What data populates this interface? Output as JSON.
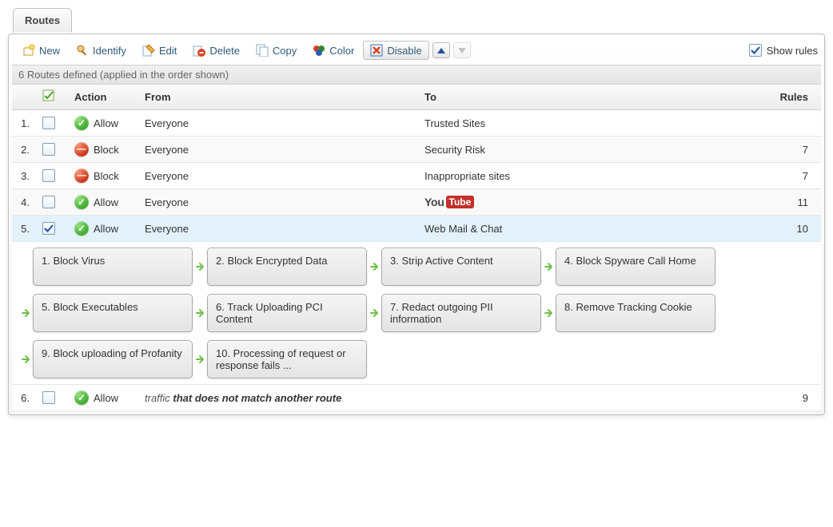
{
  "tab": {
    "label": "Routes"
  },
  "toolbar": {
    "new": {
      "label": "New",
      "icon": "new-icon"
    },
    "identify": {
      "label": "Identify",
      "icon": "identify-icon"
    },
    "edit": {
      "label": "Edit",
      "icon": "edit-icon"
    },
    "delete": {
      "label": "Delete",
      "icon": "delete-icon"
    },
    "copy": {
      "label": "Copy",
      "icon": "copy-icon"
    },
    "color": {
      "label": "Color",
      "icon": "color-icon"
    },
    "disable": {
      "label": "Disable",
      "icon": "disable-icon"
    },
    "move_up": {
      "icon": "arrow-up-icon"
    },
    "move_down": {
      "icon": "arrow-down-icon"
    },
    "show_rules": {
      "label": "Show rules",
      "checked": true
    }
  },
  "summary": "6 Routes defined (applied in the order shown)",
  "columns": {
    "select_header_icon": "select-all-icon",
    "action": "Action",
    "from": "From",
    "to": "To",
    "rules": "Rules"
  },
  "routes": [
    {
      "idx": "1.",
      "checked": false,
      "action": "Allow",
      "action_kind": "allow",
      "from": "Everyone",
      "to": "Trusted Sites",
      "rules": "",
      "selected": false
    },
    {
      "idx": "2.",
      "checked": false,
      "action": "Block",
      "action_kind": "block",
      "from": "Everyone",
      "to": "Security Risk",
      "rules": "7",
      "selected": false
    },
    {
      "idx": "3.",
      "checked": false,
      "action": "Block",
      "action_kind": "block",
      "from": "Everyone",
      "to": "Inappropriate sites",
      "rules": "7",
      "selected": false
    },
    {
      "idx": "4.",
      "checked": false,
      "action": "Allow",
      "action_kind": "allow",
      "from": "Everyone",
      "to_special": "youtube",
      "rules": "11",
      "selected": false
    },
    {
      "idx": "5.",
      "checked": true,
      "action": "Allow",
      "action_kind": "allow",
      "from": "Everyone",
      "to": "Web Mail & Chat",
      "rules": "10",
      "selected": true
    }
  ],
  "expanded_rules": [
    "1. Block Virus",
    "2. Block Encrypted Data",
    "3. Strip Active Content",
    "4. Block Spyware Call Home",
    "5. Block Executables",
    "6. Track Uploading PCI Content",
    "7. Redact outgoing PII information",
    "8. Remove Tracking Cookie",
    "9. Block uploading of Profanity",
    "10. Processing of request or response fails ..."
  ],
  "last_route": {
    "idx": "6.",
    "checked": false,
    "action": "Allow",
    "action_kind": "allow",
    "traffic_prefix": "traffic ",
    "traffic_bold": "that does not match another route",
    "rules": "9"
  },
  "youtube_logo": {
    "you": "You",
    "tube": "Tube"
  }
}
